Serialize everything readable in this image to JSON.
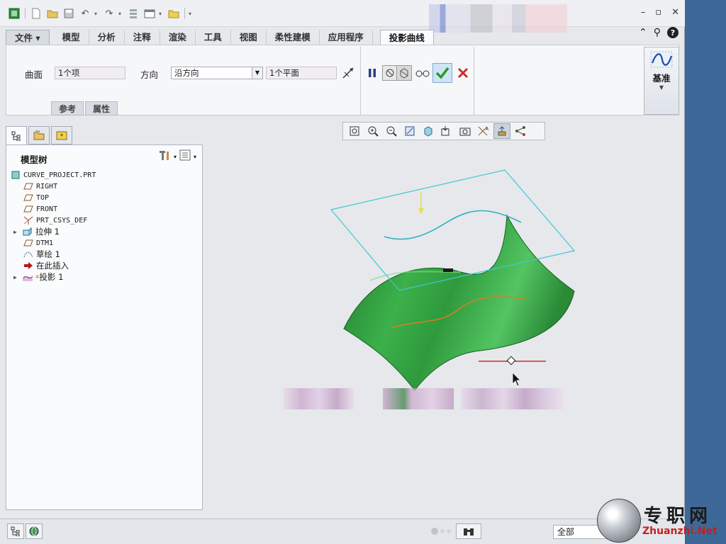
{
  "quick_access": {
    "icons": [
      "app-icon",
      "new-icon",
      "open-icon",
      "save-icon",
      "undo-icon",
      "redo-icon",
      "regenerate-icon",
      "window-icon",
      "close-window-icon",
      "customize-icon"
    ]
  },
  "ribbon": {
    "tabs": [
      "文件",
      "模型",
      "分析",
      "注释",
      "渲染",
      "工具",
      "视图",
      "柔性建模",
      "应用程序",
      "投影曲线"
    ],
    "active_tab": "投影曲线",
    "surface_label": "曲面",
    "surface_value": "1个项",
    "direction_label": "方向",
    "direction_value": "沿方向",
    "plane_value": "1个平面",
    "subtabs": [
      "参考",
      "属性"
    ],
    "datum_label": "基准"
  },
  "model_tree": {
    "title": "模型树",
    "items": [
      {
        "label": "CURVE_PROJECT.PRT",
        "icon": "part-icon",
        "indent": 0,
        "expandable": false
      },
      {
        "label": "RIGHT",
        "icon": "datum-plane-icon",
        "indent": 1,
        "expandable": false
      },
      {
        "label": "TOP",
        "icon": "datum-plane-icon",
        "indent": 1,
        "expandable": false
      },
      {
        "label": "FRONT",
        "icon": "datum-plane-icon",
        "indent": 1,
        "expandable": false
      },
      {
        "label": "PRT_CSYS_DEF",
        "icon": "csys-icon",
        "indent": 1,
        "expandable": false
      },
      {
        "label": "拉伸 1",
        "icon": "extrude-icon",
        "indent": 1,
        "expandable": true
      },
      {
        "label": "DTM1",
        "icon": "datum-plane-icon",
        "indent": 1,
        "expandable": false
      },
      {
        "label": "草绘 1",
        "icon": "sketch-icon",
        "indent": 1,
        "expandable": false
      },
      {
        "label": "在此插入",
        "icon": "insert-arrow-icon",
        "indent": 1,
        "expandable": false
      },
      {
        "label": "投影 1",
        "icon": "projection-icon",
        "indent": 1,
        "expandable": true
      }
    ]
  },
  "view_toolbar": {
    "icons": [
      "refit-icon",
      "zoom-in-icon",
      "zoom-out-icon",
      "repaint-icon",
      "display-style-icon",
      "saved-views-icon",
      "view-manager-icon",
      "datum-display-icon",
      "annotation-display-icon",
      "spin-center-icon"
    ]
  },
  "status_bar": {
    "filter_value": "全部"
  },
  "watermark": {
    "cn": "专职网",
    "en": "Zhuanzhi.Net"
  },
  "colors": {
    "surface_green": "#2e9a3c",
    "plane_cyan": "#3fc8d6",
    "curve_orange": "#e07a20",
    "accent_red": "#d22a2a",
    "confirm_green": "#2c9a2c"
  }
}
